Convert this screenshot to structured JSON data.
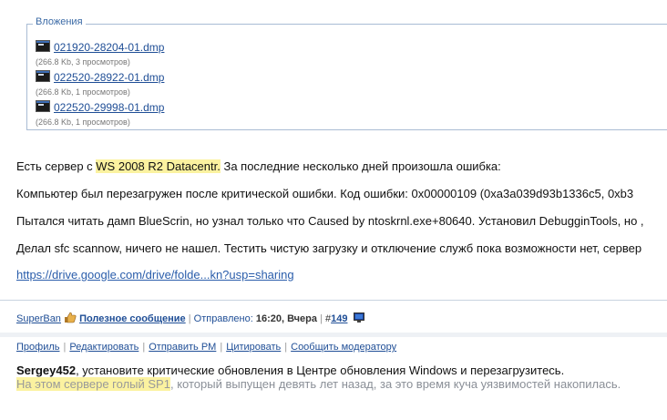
{
  "attachments": {
    "legend": "Вложения",
    "files": [
      {
        "name": "021920-28204-01.dmp",
        "meta": "(266.8 Kb, 3 просмотров)"
      },
      {
        "name": "022520-28922-01.dmp",
        "meta": "(266.8 Kb, 1 просмотров)"
      },
      {
        "name": "022520-29998-01.dmp",
        "meta": "(266.8 Kb, 1 просмотров)"
      }
    ]
  },
  "post": {
    "line1_pre": "Есть сервер с ",
    "line1_hl": "WS 2008 R2 Datacentr.",
    "line1_post": " За последние несколько дней произошла ошибка:",
    "line2": "Компьютер был перезагружен после критической ошибки. Код ошибки: 0x00000109 (0xa3a039d93b1336c5, 0xb3",
    "line3": "Пытался читать дамп BlueScrin, но узнал только что Caused by ntoskrnl.exe+80640. Установил DebugginTools, но ,",
    "line4": "Делал sfc scannow, ничего не нашел. Тестить чистую загрузку и отключение служб пока возможности нет, сервер",
    "link": "https://drive.google.com/drive/folde...kn?usp=sharing"
  },
  "signature": {
    "user": "SuperBan",
    "useful": "Полезное сообщение",
    "sent_label": "Отправлено:",
    "sent_time": "16:20, Вчера",
    "post_prefix": "#",
    "post_num": "149"
  },
  "actions": [
    "Профиль",
    "Редактировать",
    "Отправить PM",
    "Цитировать",
    "Сообщить модератору"
  ],
  "reply": {
    "user": "Sergey452",
    "line1_rest": ", установите критические обновления в Центре обновления Windows и перезагрузитесь.",
    "line2_hl": "На этом сервере голый SP1",
    "line2_rest": ", который выпущен девять лет назад, за это время куча уязвимостей накопилась."
  },
  "colors": {
    "link": "#1f4e96",
    "highlight": "#fbf2a0",
    "border": "#a9bcd4"
  }
}
